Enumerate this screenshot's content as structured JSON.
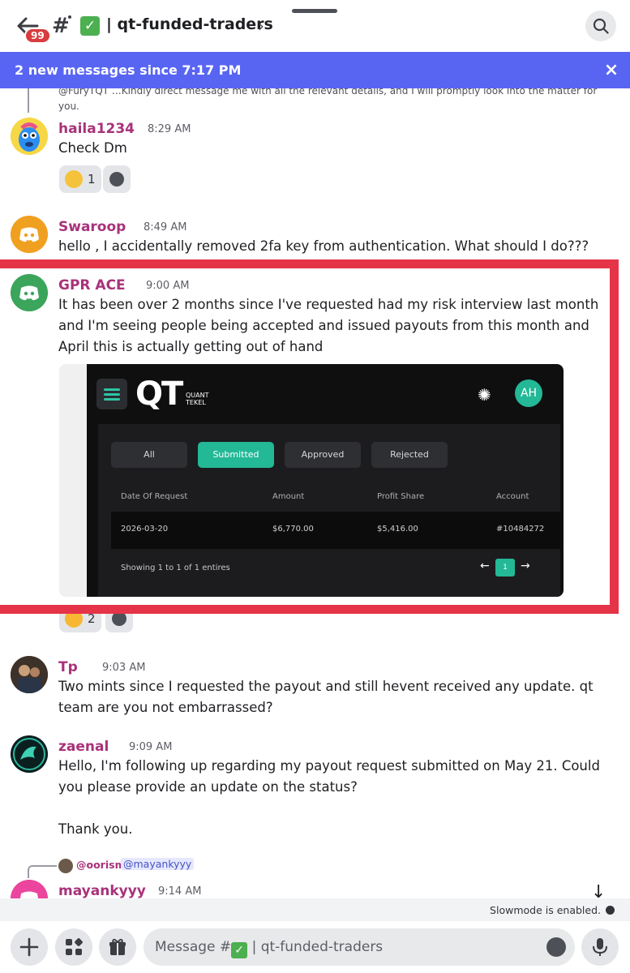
{
  "header": {
    "unread_badge": "99",
    "channel_emoji": "✓",
    "channel_name": "| qt-funded-traders",
    "chevron": "›"
  },
  "new_messages_bar": {
    "text": "2 new messages since 7:17 PM",
    "close_label": "×"
  },
  "faded_reply": {
    "text": "@FuryTQT …Kindly direct message me with all the relevant details, and I will promptly look into the matter for you."
  },
  "messages": [
    {
      "author": "haila1234",
      "time": "8:29 AM",
      "text": "Check Dm",
      "reactions": [
        {
          "emoji": "pensive-face",
          "count": "1"
        }
      ]
    },
    {
      "author": "Swaroop",
      "time": "8:49 AM",
      "text": "hello , I accidentally removed 2fa key from authentication. What should I do???"
    },
    {
      "author": "GPR ACE",
      "time": "9:00 AM",
      "text": "It has been over 2 months since I've requested had my risk interview last month and I'm seeing people being accepted and issued payouts from this month and April this is actually getting out of hand",
      "reactions": [
        {
          "emoji": "collision",
          "count": "2"
        }
      ]
    },
    {
      "author": "Tp",
      "time": "9:03 AM",
      "text": "Two mints since I requested the payout and still hevent received any update. qt team are you not embarrassed?"
    },
    {
      "author": "zaenal",
      "time": "9:09 AM",
      "text": "Hello, I'm following up regarding my payout request submitted on May 21. Could you please provide an update on the status?",
      "text2": "Thank you."
    },
    {
      "reply_to": "@oorism",
      "reply_mention": "@mayankyyy",
      "author": "mayankyyy",
      "time": "9:14 AM"
    }
  ],
  "embed": {
    "logo": "QT",
    "logo_sub_1": "QUANT",
    "logo_sub_2": "TEKEL",
    "avatar_initials": "AH",
    "tabs": [
      "All",
      "Submitted",
      "Approved",
      "Rejected"
    ],
    "active_tab": "Submitted",
    "columns": [
      "Date Of Request",
      "Amount",
      "Profit Share",
      "Account"
    ],
    "row": [
      "2026-03-20",
      "$6,770.00",
      "$5,416.00",
      "#10484272"
    ],
    "showing": "Showing 1 to 1 of 1 entires",
    "page": "1"
  },
  "slowmode": "Slowmode is enabled.",
  "composer": {
    "placeholder_prefix": "Message #",
    "placeholder_channel": "| qt-funded-traders"
  },
  "colors": {
    "accent": "#5865f2",
    "author": "#a8327a",
    "highlight": "#e53448",
    "qt_green": "#23b896",
    "badge": "#d83c3e"
  }
}
